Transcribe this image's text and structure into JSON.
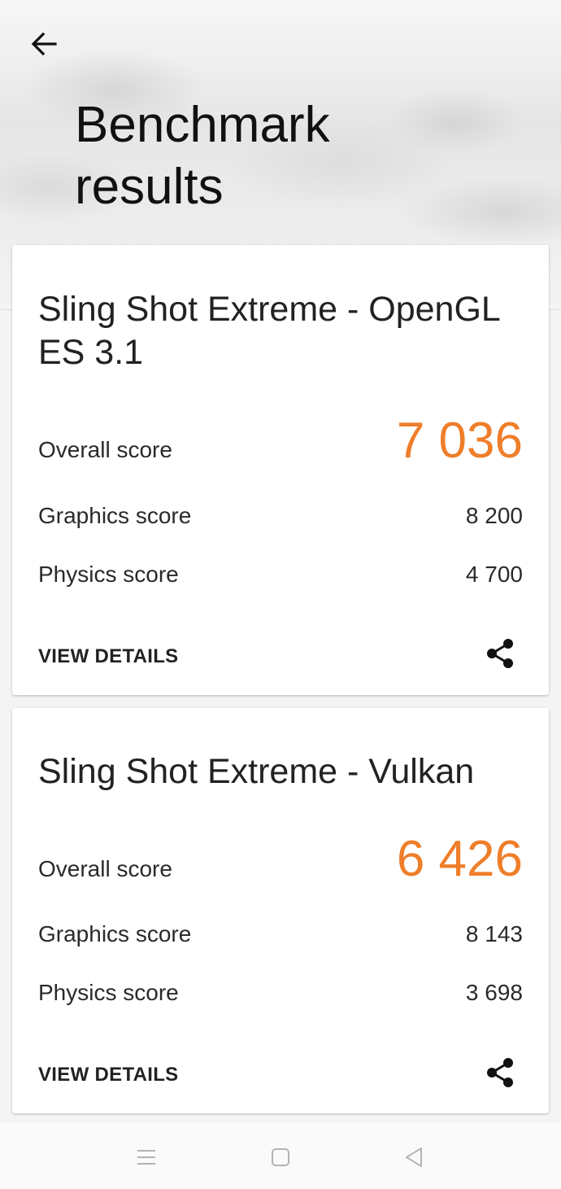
{
  "header": {
    "title": "Benchmark results",
    "back_icon": "arrow-left-icon"
  },
  "colors": {
    "accent": "#ef7e2a",
    "text": "#1f1f1f",
    "card": "#ffffff",
    "background": "#f4f4f4"
  },
  "results": [
    {
      "title": "Sling Shot Extreme - OpenGL ES 3.1",
      "overall_label": "Overall score",
      "overall_value": "7 036",
      "graphics_label": "Graphics score",
      "graphics_value": "8 200",
      "physics_label": "Physics score",
      "physics_value": "4 700",
      "details_label": "VIEW DETAILS",
      "share_icon": "share-icon"
    },
    {
      "title": "Sling Shot Extreme - Vulkan",
      "overall_label": "Overall score",
      "overall_value": "6 426",
      "graphics_label": "Graphics score",
      "graphics_value": "8 143",
      "physics_label": "Physics score",
      "physics_value": "3 698",
      "details_label": "VIEW DETAILS",
      "share_icon": "share-icon"
    }
  ],
  "navbar": {
    "icons": [
      "menu-icon",
      "home-icon",
      "back-triangle-icon"
    ]
  }
}
